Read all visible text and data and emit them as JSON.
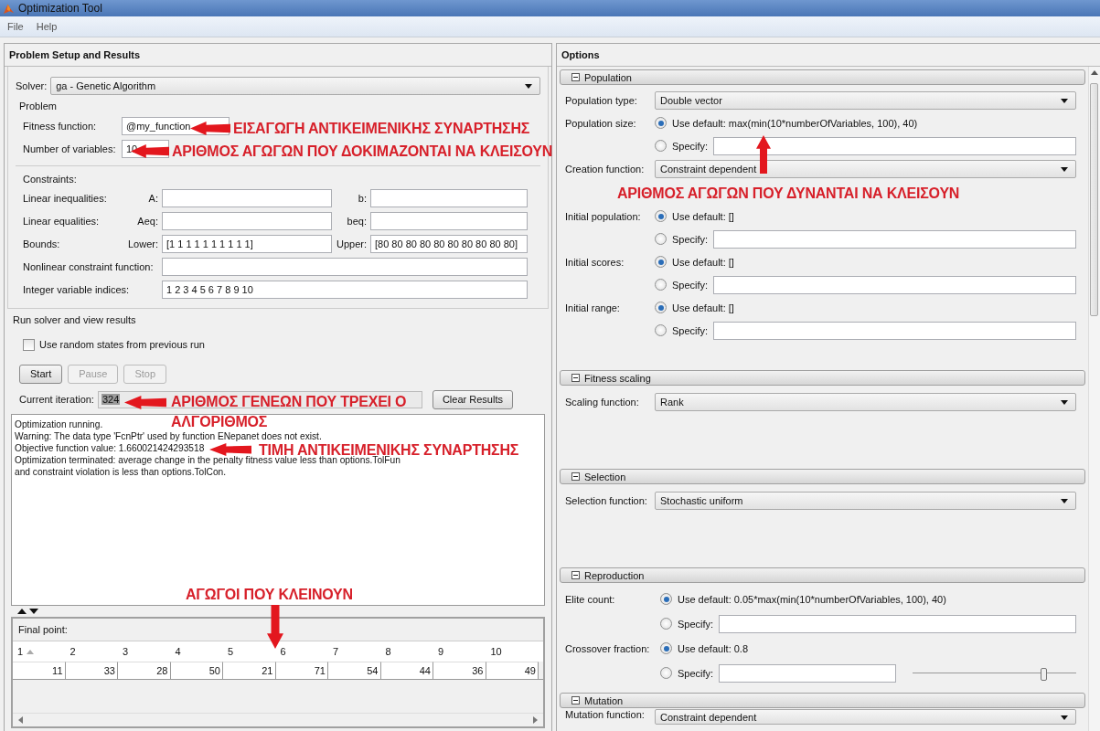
{
  "window": {
    "title": "Optimization Tool"
  },
  "menu": [
    "File",
    "Help"
  ],
  "setup": {
    "title": "Problem Setup and Results",
    "solver": {
      "label": "Solver:",
      "value": "ga - Genetic Algorithm"
    },
    "problem_heading": "Problem",
    "problem_fields": [
      {
        "label": "Fitness function:",
        "value": "@my_function"
      },
      {
        "label": "Number of variables:",
        "value": "10"
      }
    ],
    "constraints_heading": "Constraints:",
    "constraints": [
      {
        "kind": "pair",
        "label": "Linear inequalities:",
        "fields": [
          {
            "label": "A:"
          },
          {
            "label": "b:"
          }
        ]
      },
      {
        "kind": "pair",
        "label": "Linear equalities:",
        "fields": [
          {
            "label": "Aeq:"
          },
          {
            "label": "beq:"
          }
        ]
      },
      {
        "kind": "pair",
        "label": "Bounds:",
        "fields": [
          {
            "label": "Lower:",
            "value": "[1 1 1 1 1 1 1 1 1 1]"
          },
          {
            "label": "Upper:",
            "value": "[80 80 80 80 80 80 80 80 80 80]"
          }
        ]
      },
      {
        "kind": "single",
        "label": "Nonlinear constraint function:"
      },
      {
        "kind": "single",
        "label": "Integer variable indices:",
        "value": "1 2 3 4 5 6 7 8 9 10"
      }
    ]
  },
  "run": {
    "heading": "Run solver and view results",
    "checkbox": {
      "label": "Use random states from previous run",
      "checked": false
    },
    "buttons": [
      {
        "label": "Start",
        "disabled": false
      },
      {
        "label": "Pause",
        "disabled": true
      },
      {
        "label": "Stop",
        "disabled": true
      }
    ],
    "iteration": {
      "label": "Current iteration:",
      "value": "324"
    },
    "clear_button": "Clear Results",
    "output": [
      "Optimization running.",
      "Warning: The data type 'FcnPtr' used by function ENepanet does not exist.",
      "Objective function value: 1.660021424293518",
      "Optimization terminated: average change in the penalty fitness value less than options.TolFun",
      "and constraint violation is less than options.TolCon."
    ]
  },
  "final_point": {
    "label": "Final point:",
    "columns": [
      {
        "label": "1",
        "sorted": true
      },
      {
        "label": "2",
        "sorted": false
      },
      {
        "label": "3",
        "sorted": false
      },
      {
        "label": "4",
        "sorted": false
      },
      {
        "label": "5",
        "sorted": false
      },
      {
        "label": "6",
        "sorted": false
      },
      {
        "label": "7",
        "sorted": false
      },
      {
        "label": "8",
        "sorted": false
      },
      {
        "label": "9",
        "sorted": false
      },
      {
        "label": "10",
        "sorted": false
      }
    ],
    "values": [
      "11",
      "33",
      "28",
      "50",
      "21",
      "71",
      "54",
      "44",
      "36",
      "49"
    ]
  },
  "options": {
    "title": "Options",
    "sections": [
      {
        "title": "Population",
        "expanded": true,
        "rows": [
          {
            "kind": "dropdown",
            "label": "Population type:",
            "value": "Double vector"
          },
          {
            "kind": "radio",
            "label": "Population size:",
            "choices": [
              {
                "kind": "default",
                "label": "Use default: max(min(10*numberOfVariables, 100), 40)",
                "selected": true
              },
              {
                "kind": "specify",
                "label": "Specify:",
                "selected": false
              }
            ]
          },
          {
            "kind": "dropdown",
            "label": "Creation function:",
            "value": "Constraint dependent"
          },
          {
            "kind": "radio",
            "label": "Initial population:",
            "choices": [
              {
                "kind": "default",
                "label": "Use default: []",
                "selected": true
              },
              {
                "kind": "specify",
                "label": "Specify:",
                "selected": false
              }
            ]
          },
          {
            "kind": "radio",
            "label": "Initial scores:",
            "choices": [
              {
                "kind": "default",
                "label": "Use default: []",
                "selected": true
              },
              {
                "kind": "specify",
                "label": "Specify:",
                "selected": false
              }
            ]
          },
          {
            "kind": "radio",
            "label": "Initial range:",
            "choices": [
              {
                "kind": "default",
                "label": "Use default: []",
                "selected": true
              },
              {
                "kind": "specify",
                "label": "Specify:",
                "selected": false
              }
            ]
          }
        ]
      },
      {
        "title": "Fitness scaling",
        "expanded": true,
        "rows": [
          {
            "kind": "dropdown",
            "label": "Scaling function:",
            "value": "Rank"
          }
        ]
      },
      {
        "title": "Selection",
        "expanded": true,
        "rows": [
          {
            "kind": "dropdown",
            "label": "Selection function:",
            "value": "Stochastic uniform"
          }
        ]
      },
      {
        "title": "Reproduction",
        "expanded": true,
        "rows": [
          {
            "kind": "radio",
            "label": "Elite count:",
            "choices": [
              {
                "kind": "default",
                "label": "Use default: 0.05*max(min(10*numberOfVariables, 100), 40)",
                "selected": true
              },
              {
                "kind": "specify",
                "label": "Specify:",
                "selected": false
              }
            ]
          },
          {
            "kind": "radio",
            "label": "Crossover fraction:",
            "choices": [
              {
                "kind": "default",
                "label": "Use default: 0.8",
                "selected": true
              },
              {
                "kind": "specify",
                "label": "Specify:",
                "selected": false,
                "slider": {
                  "level": 0.8
                }
              }
            ]
          }
        ]
      },
      {
        "title": "Mutation",
        "expanded": true,
        "rows": [
          {
            "kind": "dropdown",
            "label": "Mutation function:",
            "value": "Constraint dependent"
          }
        ]
      }
    ]
  },
  "annotations": [
    {
      "kind": "left",
      "text": "ΕΙΣΑΓΩΓΗ ΑΝΤΙΚΕΙΜΕΝΙΚΗΣ ΣΥΝΑΡΤΗΣΗΣ"
    },
    {
      "kind": "left",
      "text": "ΑΡΙΘΜΟΣ ΑΓΩΓΩΝ ΠΟΥ ΔΟΚΙΜΑΖΟΝΤΑΙ ΝΑ ΚΛΕΙΣΟΥΝ"
    },
    {
      "kind": "up",
      "text": "ΑΡΙΘΜΟΣ ΑΓΩΓΩΝ ΠΟΥ ΔΥΝΑΝΤΑΙ ΝΑ ΚΛΕΙΣΟΥΝ"
    },
    {
      "kind": "left",
      "text": "ΑΡΙΘΜΟΣ ΓΕΝΕΩΝ ΠΟΥ ΤΡΕΧΕΙ Ο ΑΛΓΟΡΙΘΜΟΣ"
    },
    {
      "kind": "left",
      "text": "ΤΙΜΗ ΑΝΤΙΚΕΙΜΕΝΙΚΗΣ ΣΥΝΑΡΤΗΣΗΣ"
    },
    {
      "kind": "down",
      "text": "ΑΓΩΓΟΙ ΠΟΥ ΚΛΕΙΝΟΥΝ"
    }
  ]
}
